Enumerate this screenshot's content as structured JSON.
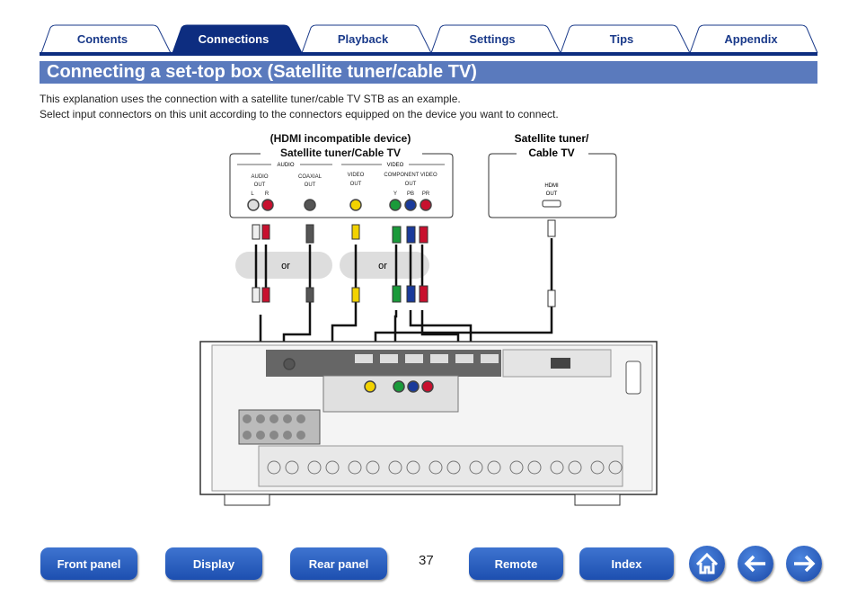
{
  "tabs": [
    "Contents",
    "Connections",
    "Playback",
    "Settings",
    "Tips",
    "Appendix"
  ],
  "active_tab": "Connections",
  "title": "Connecting a set-top box (Satellite tuner/cable TV)",
  "intro": [
    "This explanation uses the connection with a satellite tuner/cable TV STB as an example.",
    "Select input connectors on this unit according to the connectors equipped on the device you want to connect."
  ],
  "diagram": {
    "device1": {
      "title1": "(HDMI incompatible device)",
      "title2": "Satellite tuner/Cable TV",
      "audio_group": "AUDIO",
      "video_group": "VIDEO",
      "audio_out": "AUDIO",
      "audio_out2": "OUT",
      "l": "L",
      "r": "R",
      "coaxial": "COAXIAL",
      "coaxial2": "OUT",
      "video": "VIDEO",
      "video2": "OUT",
      "component": "COMPONENT VIDEO",
      "component2": "OUT",
      "y": "Y",
      "pb": "PB",
      "pr": "PR"
    },
    "device2": {
      "title1": "Satellite tuner/",
      "title2": "Cable TV",
      "hdmi": "HDMI",
      "hdmi2": "OUT"
    },
    "or1": "or",
    "or2": "or"
  },
  "colors": {
    "tab_active": "#0d2d80",
    "title_bar": "#5a7abd",
    "button": "#2a5cc0"
  },
  "footer": {
    "front_panel": "Front panel",
    "display": "Display",
    "rear_panel": "Rear panel",
    "page": "37",
    "remote": "Remote",
    "index": "Index"
  }
}
